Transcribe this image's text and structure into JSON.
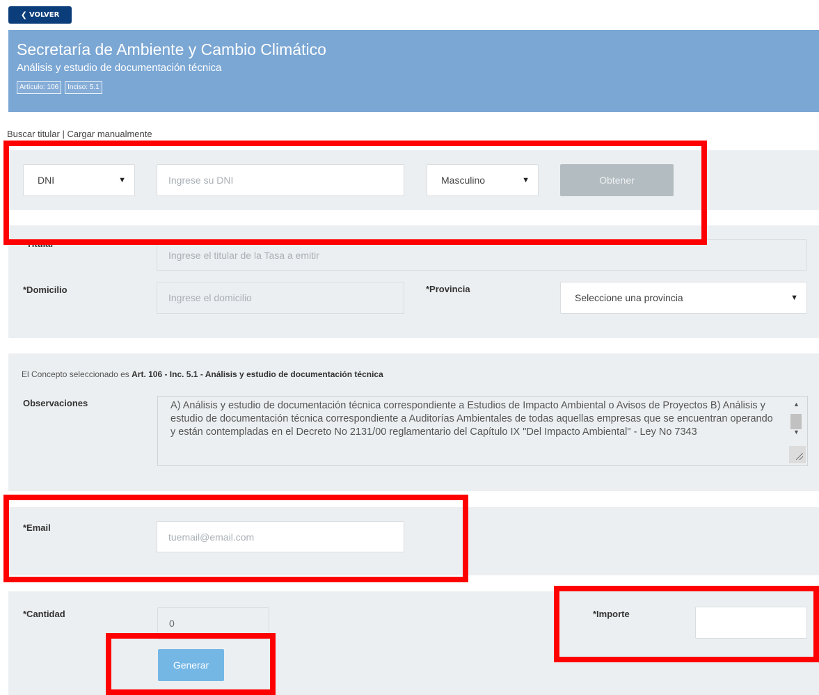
{
  "nav": {
    "back_label": "VOLVER",
    "back_icon": "chevron-left-icon"
  },
  "header": {
    "title": "Secretaría de Ambiente y Cambio Climático",
    "subtitle": "Análisis y estudio de documentación técnica",
    "tags": [
      "Artículo: 106",
      "Inciso: 5.1"
    ]
  },
  "search": {
    "link_buscar": "Buscar titular",
    "separator": " | ",
    "link_cargar": "Cargar manualmente",
    "doc_type": "DNI",
    "doc_placeholder": "Ingrese su DNI",
    "gender": "Masculino",
    "obtener_label": "Obtener"
  },
  "titular": {
    "titular_label": "*Titular",
    "titular_placeholder": "Ingrese el titular de la Tasa a emitir",
    "domicilio_label": "*Domicilio",
    "domicilio_placeholder": "Ingrese el domicilio",
    "provincia_label": "*Provincia",
    "provincia_value": "Seleccione una provincia"
  },
  "concepto": {
    "prefix": "El Concepto seleccionado es ",
    "value": "Art. 106 - Inc. 5.1 - Análisis y estudio de documentación técnica",
    "observaciones_label": "Observaciones",
    "observaciones_text": "A) Análisis y estudio de documentación técnica correspondiente a Estudios de Impacto Ambiental o Avisos de Proyectos B) Análisis y estudio de documentación técnica correspondiente a Auditorías Ambientales de todas aquellas empresas que se encuentran operando y están contempladas en el Decreto No 2131/00 reglamentario del Capítulo IX \"Del Impacto Ambiental\" - Ley No 7343"
  },
  "email": {
    "label": "*Email",
    "placeholder": "tuemail@email.com"
  },
  "cantidad": {
    "label": "*Cantidad",
    "value": "0"
  },
  "importe": {
    "label": "*Importe",
    "value": ""
  },
  "generar_label": "Generar",
  "colors": {
    "header_bg": "#7ba7d4",
    "back_button_bg": "#0a3d7a",
    "panel_bg": "#eceff1",
    "highlight": "#ff0000",
    "generar_bg": "#74b7e5",
    "obtener_bg": "#b3bcc1"
  }
}
